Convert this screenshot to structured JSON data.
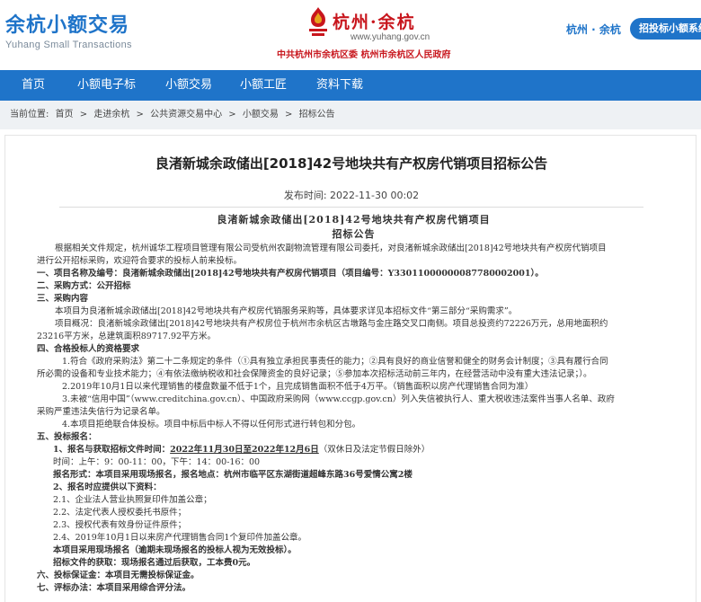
{
  "brand": {
    "name": "余杭小额交易",
    "subtitle": "Yuhang Small Transactions"
  },
  "center_logo": {
    "name": "杭州·余杭",
    "url": "www.yuhang.gov.cn",
    "gov_line": "中共杭州市余杭区委  杭州市余杭区人民政府"
  },
  "header": {
    "region": "杭州 · 余杭",
    "entry_button": "招投标小额系统"
  },
  "nav": [
    "首页",
    "小额电子标",
    "小额交易",
    "小额工匠",
    "资料下载"
  ],
  "breadcrumb": [
    "当前位置:",
    "首页",
    ">",
    "走进余杭",
    ">",
    "公共资源交易中心",
    ">",
    "小额交易",
    ">",
    "招标公告"
  ],
  "page_title": "良渚新城余政储出[2018]42号地块共有产权房代销项目招标公告",
  "publish_time": "发布时间: 2022-11-30 00:02",
  "doc": {
    "title": "良渚新城余政储出[2018]42号地块共有产权房代销项目",
    "subtitle": "招标公告",
    "lines": [
      "根据相关文件规定，杭州诚华工程项目管理有限公司受杭州农副物流管理有限公司委托，对良渚新城余政储出[2018]42号地块共有产权房代销项目",
      "进行公开招标采购，欢迎符合要求的投标人前来投标。",
      "一、项目名称及编号：良渚新城余政储出[2018]42号地块共有产权房代销项目（项目编号：Y33011000000087780002001）。",
      "二、采购方式：公开招标",
      "三、采购内容",
      "本项目为良渚新城余政储出[2018]42号地块共有产权房代销服务采购等，具体要求详见本招标文件“第三部分“采购需求”。",
      "项目概况：良渚新城余政储出[2018]42号地块共有产权房位于杭州市余杭区古墩路与金庄路交叉口南侧。项目总投资约72226万元，总用地面积约",
      "23216平方米，总建筑面积89717.92平方米。",
      "四、合格投标人的资格要求",
      "1.符合《政府采购法》第二十二条规定的条件（①具有独立承担民事责任的能力；②具有良好的商业信誉和健全的财务会计制度；③具有履行合同",
      "所必需的设备和专业技术能力；④有依法缴纳税收和社会保障资金的良好记录；⑤参加本次招标活动前三年内，在经营活动中没有重大违法记录；）。",
      "2.2019年10月1日以来代理销售的楼盘数量不低于1个，且完成销售面积不低于4万平。（销售面积以房产代理销售合同为准）",
      "3.未被“信用中国”（www.creditchina.gov.cn）、中国政府采购网（www.ccgp.gov.cn）列入失信被执行人、重大税收违法案件当事人名单、政府",
      "采购严重违法失信行为记录名单。",
      "4.本项目拒绝联合体投标。项目中标后中标人不得以任何形式进行转包和分包。",
      "五、投标报名：",
      "1、报名与获取招标文件时间：",
      "2022年11月30日至2022年12月6日",
      "（双休日及法定节假日除外）",
      "时间：上午：9：00-11：00，下午：14：00-16：00",
      "报名形式：本项目采用现场报名，报名地点：杭州市临平区东湖街道超峰东路36号爱情公寓2楼",
      "2、报名时应提供以下资料：",
      "2.1、企业法人营业执照复印件加盖公章；",
      "2.2、法定代表人授权委托书原件；",
      "2.3、授权代表有效身份证件原件；",
      "2.4、2019年10月1日以来房产代理销售合同1个复印件加盖公章。",
      "本项目采用现场报名（逾期未现场报名的投标人视为无效投标）。",
      "招标文件的获取：现场报名通过后获取，工本费0元。",
      "六、投标保证金：本项目无需投标保证金。",
      "七、评标办法：本项目采用综合评分法。"
    ]
  },
  "colors": {
    "accent": "#1f74c9",
    "gov_red": "#c8161d",
    "breadcrumb_bg": "#eef1f4"
  }
}
